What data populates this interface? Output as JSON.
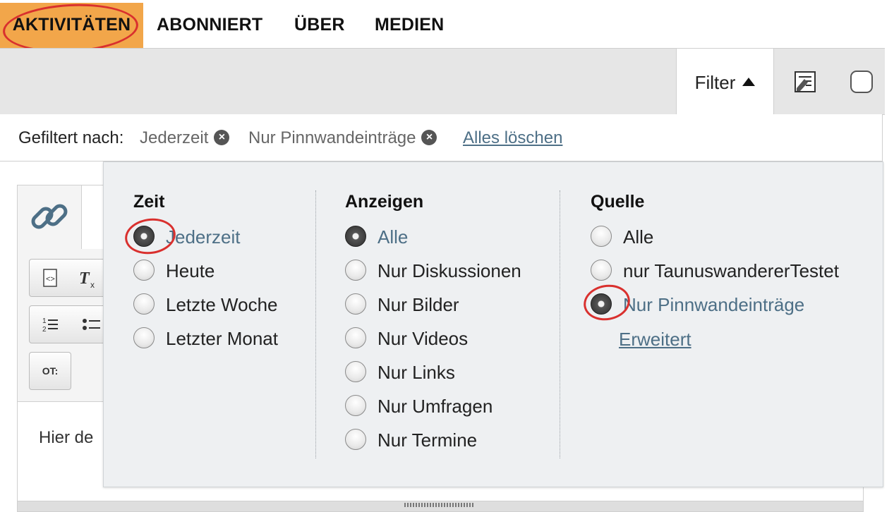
{
  "nav": {
    "tabs": [
      {
        "label": "AKTIVITÄTEN",
        "active": true
      },
      {
        "label": "ABONNIERT",
        "active": false
      },
      {
        "label": "ÜBER",
        "active": false
      },
      {
        "label": "MEDIEN",
        "active": false
      }
    ]
  },
  "toolbar": {
    "filter_label": "Filter",
    "edit_icon": "edit-list-icon",
    "checkbox_icon": "select-checkbox-icon"
  },
  "summary": {
    "label": "Gefiltert nach:",
    "chips": [
      "Jederzeit",
      "Nur Pinnwandeinträge"
    ],
    "clear_all": "Alles löschen"
  },
  "editor": {
    "placeholder": "Hier de",
    "quote_button": "OT:"
  },
  "filter_panel": {
    "zeit": {
      "heading": "Zeit",
      "options": [
        {
          "label": "Jederzeit",
          "selected": true
        },
        {
          "label": "Heute",
          "selected": false
        },
        {
          "label": "Letzte Woche",
          "selected": false
        },
        {
          "label": "Letzter Monat",
          "selected": false
        }
      ]
    },
    "anzeigen": {
      "heading": "Anzeigen",
      "options": [
        {
          "label": "Alle",
          "selected": true
        },
        {
          "label": "Nur Diskussionen",
          "selected": false
        },
        {
          "label": "Nur Bilder",
          "selected": false
        },
        {
          "label": "Nur Videos",
          "selected": false
        },
        {
          "label": "Nur Links",
          "selected": false
        },
        {
          "label": "Nur Umfragen",
          "selected": false
        },
        {
          "label": "Nur Termine",
          "selected": false
        }
      ]
    },
    "quelle": {
      "heading": "Quelle",
      "options": [
        {
          "label": "Alle",
          "selected": false
        },
        {
          "label": "nur TaunuswandererTestet",
          "selected": false
        },
        {
          "label": "Nur Pinnwandeinträge",
          "selected": true
        }
      ],
      "advanced_link": "Erweitert"
    }
  },
  "colors": {
    "active_tab": "#f2a64a",
    "link": "#4d6f86",
    "annotation": "#d9302e"
  }
}
